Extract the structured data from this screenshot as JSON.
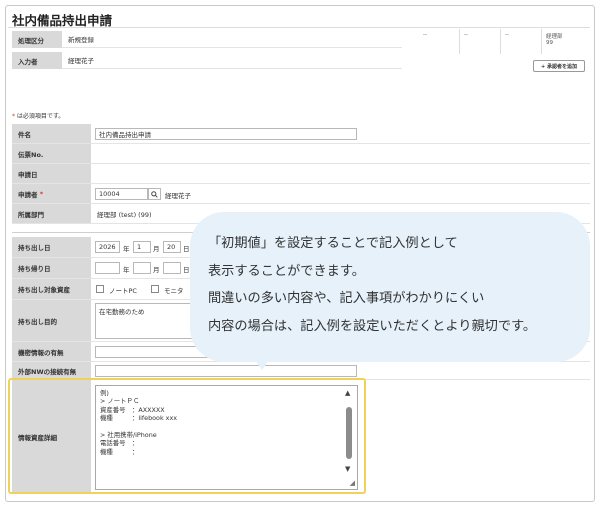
{
  "page": {
    "title": "社内備品持出申請"
  },
  "header_fields": [
    {
      "label": "処理区分",
      "value": "新規登録"
    },
    {
      "label": "入力者",
      "value": "経理花子"
    }
  ],
  "approval": {
    "cells": [
      "--",
      "--",
      "--"
    ],
    "last_cell_name": "経理部",
    "last_cell_value": "99",
    "add_button": "+ 承認者を追加"
  },
  "required_note": {
    "star": "*",
    "text": " は必須項目です。"
  },
  "fields": {
    "subject": {
      "label": "件名",
      "value": "社内備品持出申請"
    },
    "slip_no": {
      "label": "伝票No."
    },
    "application_date": {
      "label": "申請日"
    },
    "applicant": {
      "label": "申請者",
      "required_star": "*",
      "code": "10004",
      "name": "経理花子"
    },
    "department": {
      "label": "所属部門",
      "value": "経理部 (test) (99)"
    },
    "takeout_date": {
      "label": "持ち出し日",
      "year": "2026",
      "year_unit": "年",
      "month": "1",
      "month_unit": "月",
      "day": "20",
      "day_unit": "日"
    },
    "return_date": {
      "label": "持ち帰り日",
      "year_unit": "年",
      "month_unit": "月",
      "day_unit": "日"
    },
    "assets": {
      "label": "持ち出し対象資産",
      "options": [
        "ノートPC",
        "モニタ"
      ]
    },
    "purpose": {
      "label": "持ち出し目的",
      "value": "在宅勤務のため"
    },
    "confidential": {
      "label": "機密情報の有無"
    },
    "external_nw": {
      "label": "外部NWの接続有無"
    },
    "asset_details": {
      "label": "情報資産詳細",
      "lines": [
        "例)",
        "> ノートＰＣ",
        "資産番号　：AXXXXX",
        "機種　　　：lifebook xxx",
        "",
        "> 社用携帯/iPhone",
        "電話番号　：",
        "機種　　　："
      ]
    }
  },
  "bubble": {
    "lines": [
      "「初期値」を設定することで記入例として",
      "表示することができます。",
      "間違いの多い内容や、記入事項がわかりにくい",
      "内容の場合は、記入例を設定いただくとより親切です。"
    ]
  }
}
